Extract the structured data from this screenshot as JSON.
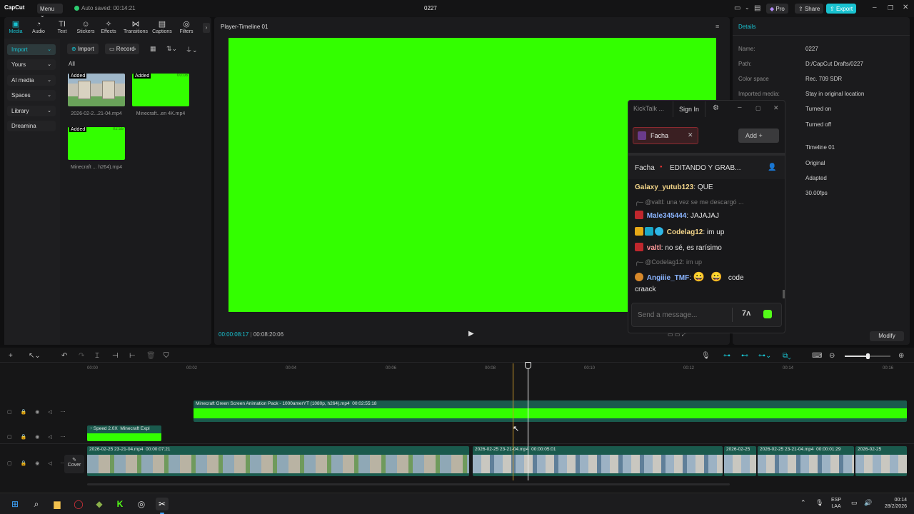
{
  "app": {
    "logo": "CapCut",
    "menu_label": "Menu",
    "autosave": "Auto saved: 00:14:21",
    "project_title": "0227",
    "pro_label": "Pro",
    "share_label": "Share",
    "export_label": "Export"
  },
  "toolbar": {
    "items": [
      {
        "label": "Media",
        "icon": "▣"
      },
      {
        "label": "Audio",
        "icon": "◔"
      },
      {
        "label": "Text",
        "icon": "TI"
      },
      {
        "label": "Stickers",
        "icon": "☺"
      },
      {
        "label": "Effects",
        "icon": "✧"
      },
      {
        "label": "Transitions",
        "icon": "⋈"
      },
      {
        "label": "Captions",
        "icon": "▤"
      },
      {
        "label": "Filters",
        "icon": "◎"
      }
    ]
  },
  "media_sidebar": {
    "items": [
      "Import",
      "Yours",
      "AI media",
      "Spaces",
      "Library",
      "Dreamina"
    ]
  },
  "media_panel": {
    "import_btn": "Import",
    "record_btn": "Record",
    "filter_all": "All",
    "clips": [
      {
        "name": "2026-02-2...21-04.mp4",
        "badge": "Added",
        "duration": ""
      },
      {
        "name": "Minecraft...en 4K.mp4",
        "badge": "Added",
        "duration": "00:08"
      },
      {
        "name": "Minecraft ... h264).mp4",
        "badge": "Added",
        "duration": "02:55"
      }
    ]
  },
  "player": {
    "title": "Player-Timeline 01",
    "current_time": "00:00:08:17",
    "total_time": "00:08:20:06"
  },
  "details": {
    "title": "Details",
    "rows": [
      {
        "key": "Name:",
        "value": "0227"
      },
      {
        "key": "Path:",
        "value": "D:/CapCut Drafts/0227"
      },
      {
        "key": "Color space",
        "value": "Rec. 709 SDR"
      },
      {
        "key": "Imported media:",
        "value": "Stay in original location"
      },
      {
        "key": "",
        "value": "Turned on"
      },
      {
        "key": "",
        "value": "Turned off"
      },
      {
        "key": "",
        "value": "Timeline 01"
      },
      {
        "key": "",
        "value": "Original"
      },
      {
        "key": "",
        "value": "Adapted"
      },
      {
        "key": "",
        "value": "30.00fps"
      }
    ],
    "modify_btn": "Modify"
  },
  "kicktalk": {
    "title": "KickTalk ...",
    "sign_in": "Sign In",
    "tab_name": "Facha",
    "add_btn": "Add",
    "channel_name": "Facha",
    "stream_title": "EDITANDO Y GRAB...",
    "messages": [
      {
        "type": "msg",
        "user": "Galaxy_yutub123",
        "color": "#f5d68a",
        "text": "QUE"
      },
      {
        "type": "reply",
        "text": "@valtl: una vez se me descargó ..."
      },
      {
        "type": "msg",
        "user": "Male345444",
        "color": "#8ab4ff",
        "text": "JAJAJAJ"
      },
      {
        "type": "msg",
        "user": "Codelag12",
        "color": "#f5d68a",
        "text": "im up"
      },
      {
        "type": "msg",
        "user": "valtl",
        "color": "#ff9a9a",
        "text": "no sé, es rarísimo"
      },
      {
        "type": "reply",
        "text": "@Codelag12: im up"
      },
      {
        "type": "msg",
        "user": "Angiiie_TMF",
        "color": "#8ab4ff",
        "text": "code"
      },
      {
        "type": "cont",
        "text": "craack"
      }
    ],
    "input_placeholder": "Send a message..."
  },
  "timeline": {
    "ruler": [
      "00:00",
      "00:02",
      "00:04",
      "00:06",
      "00:08",
      "00:10",
      "00:12",
      "00:14",
      "00:16"
    ],
    "clips": {
      "overlay": "Minecraft Green Screen Animation Pack - 1000amerYT (1080p, h264).mp4",
      "overlay_dur": "00:02:55:18",
      "small_speed": "Speed 2.0X",
      "small_name": "Minecraft Expl",
      "main1": "2026-02-25 23-21-04.mp4",
      "main1_dur": "00:00:07:21",
      "main2": "2026-02-25 23-21-04.mp4",
      "main2_dur": "00:00:05:01",
      "main3": "2026-02-25",
      "main4": "2026-02-25 23-21-04.mp4",
      "main4_dur": "00:00:01:29",
      "main5": "2026-02-25"
    },
    "cover_label": "Cover"
  },
  "taskbar": {
    "lang": "ESP",
    "lang2": "LAA",
    "time": "00:14",
    "date": "28/2/2026"
  },
  "colors": {
    "accent": "#19c2d0",
    "green_screen": "#33ff00",
    "kick_green": "#53fc18"
  }
}
